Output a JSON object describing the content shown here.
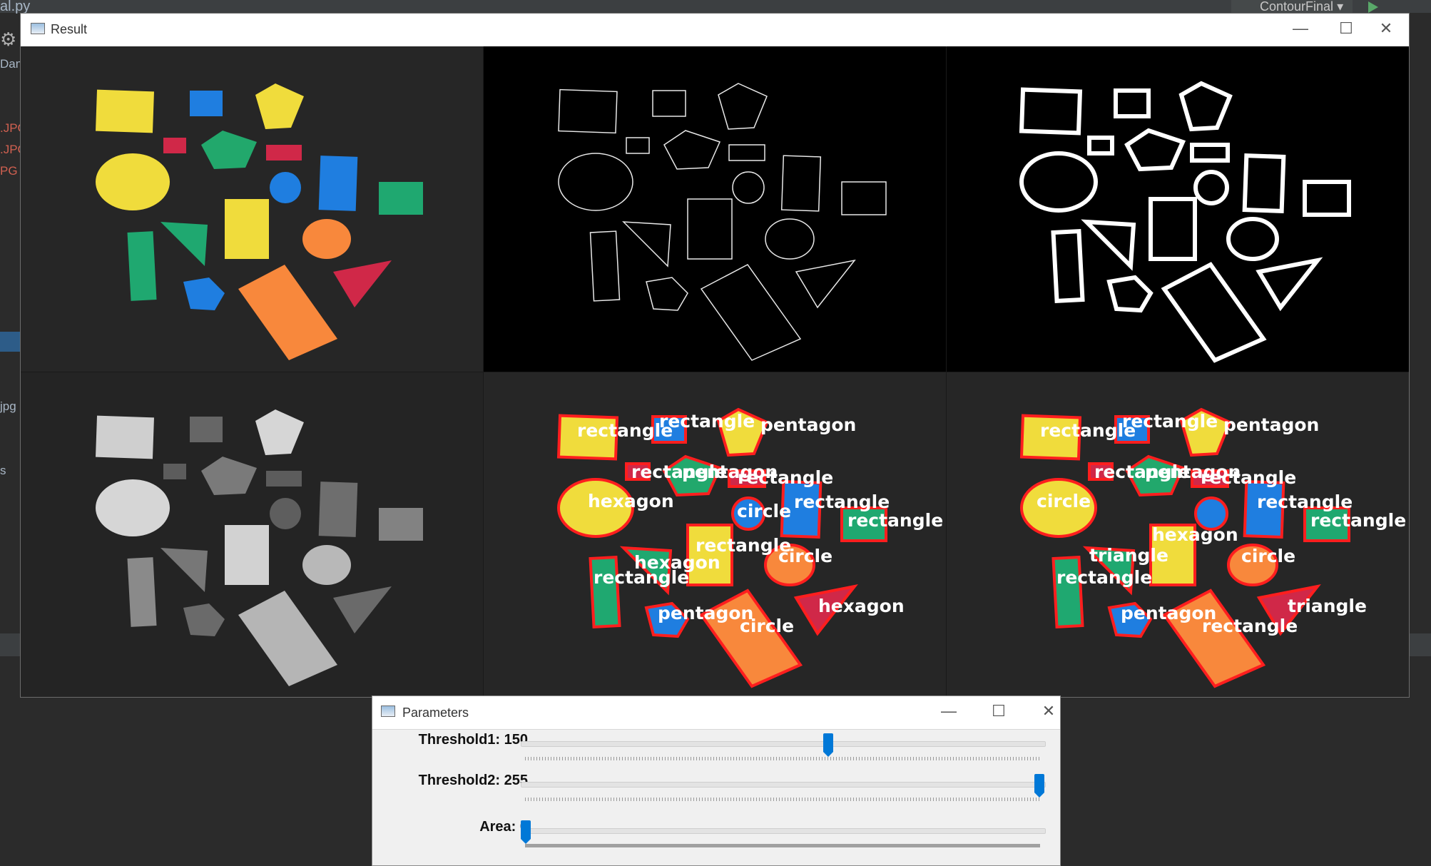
{
  "ide": {
    "file_tab": "al.py",
    "run_config": "ContourFinal",
    "project_items": [
      "Dan",
      ".JPG",
      ".JPG",
      "PG",
      "jpg",
      "s"
    ]
  },
  "result_window": {
    "title": "Result",
    "controls": {
      "minimize": "—",
      "maximize": "☐",
      "close": "✕"
    }
  },
  "shape_labels_contour": [
    "rectangle",
    "rectangle",
    "pentagon",
    "rectangle",
    "pentagon",
    "rectangle",
    "hexagon",
    "circle",
    "rectangle",
    "rectangle",
    "hexagon",
    "rectangle",
    "circle",
    "rectangle",
    "pentagon",
    "circle",
    "hexagon"
  ],
  "shape_labels_final": [
    "rectangle",
    "rectangle",
    "pentagon",
    "rectangle",
    "pentagon",
    "rectangle",
    "circle",
    "rectangle",
    "rectangle",
    "hexagon",
    "triangle",
    "circle",
    "rectangle",
    "pentagon",
    "rectangle",
    "triangle"
  ],
  "params_window": {
    "title": "Parameters",
    "controls": {
      "minimize": "—",
      "maximize": "☐",
      "close": "✕"
    },
    "sliders": [
      {
        "label": "Threshold1: 150",
        "value": 150,
        "max": 255
      },
      {
        "label": "Threshold2: 255",
        "value": 255,
        "max": 255
      },
      {
        "label": "Area: 0",
        "value": 0,
        "max": 30000
      }
    ]
  }
}
